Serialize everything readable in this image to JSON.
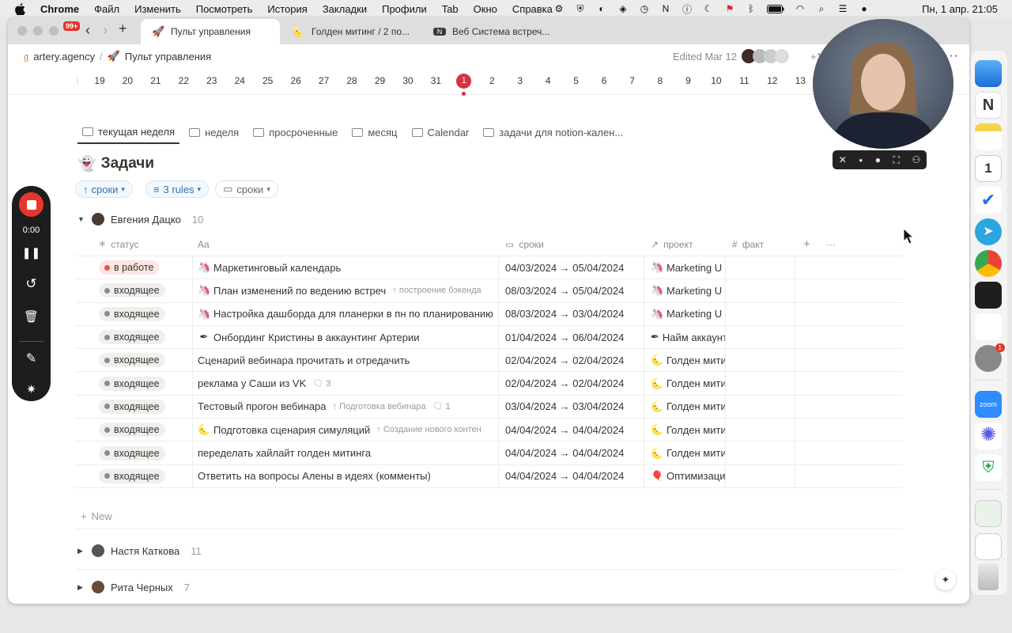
{
  "menubar": {
    "app": "Chrome",
    "items": [
      "Файл",
      "Изменить",
      "Посмотреть",
      "История",
      "Закладки",
      "Профили",
      "Tab",
      "Окно",
      "Справка"
    ],
    "clock": "Пн, 1 апр. 21:05"
  },
  "browser": {
    "tab_count_badge": "99+",
    "tabs": [
      {
        "label": "Пульт управления",
        "icon": "rocket-icon"
      },
      {
        "label": "Голден митинг / 2 по...",
        "icon": "moon-icon"
      },
      {
        "label": "Веб Система встреч...",
        "icon": "notion-icon"
      }
    ]
  },
  "breadcrumb": {
    "workspace": "artery.agency",
    "separator": "/",
    "page": "Пульт управления",
    "edited": "Edited Mar 12",
    "extra_avatars": "+1"
  },
  "datebar": {
    "dates": [
      "19",
      "20",
      "21",
      "22",
      "23",
      "24",
      "25",
      "26",
      "27",
      "28",
      "29",
      "30",
      "31",
      "1",
      "2",
      "3",
      "4",
      "5",
      "6",
      "7",
      "8",
      "9",
      "10",
      "11",
      "12",
      "13"
    ],
    "today_index": 13
  },
  "views": [
    "текущая неделя",
    "неделя",
    "просроченные",
    "месяц",
    "Calendar",
    "задачи для notion-кален..."
  ],
  "database": {
    "title": "Задачи",
    "sort_chip": "сроки",
    "rules_chip": "3 rules",
    "filter_chip": "сроки"
  },
  "groups": [
    {
      "name": "Евгения Дацко",
      "count": "10"
    },
    {
      "name": "Настя Каткова",
      "count": "11"
    },
    {
      "name": "Рита Черных",
      "count": "7"
    }
  ],
  "columns": {
    "status": "статус",
    "name": "Aa",
    "dates": "сроки",
    "project": "проект",
    "fact": "факт"
  },
  "rows": [
    {
      "status": "в работе",
      "status_color": "#e1584b",
      "icon": "unicorn",
      "title": "Маркетинговый календарь",
      "sub": "",
      "comments": "",
      "dates": "04/03/2024 → 05/04/2024",
      "project_icon": "unicorn",
      "project": "Marketing U"
    },
    {
      "status": "входящее",
      "status_color": "#8d8b86",
      "icon": "unicorn",
      "title": "План изменений по ведению встреч",
      "sub": "построение бэкенда",
      "comments": "",
      "dates": "08/03/2024 → 05/04/2024",
      "project_icon": "unicorn",
      "project": "Marketing U"
    },
    {
      "status": "входящее",
      "status_color": "#8d8b86",
      "icon": "unicorn",
      "title": "Настройка дашборда для планерки в пн по планированию",
      "sub": "",
      "comments": "",
      "dates": "08/03/2024 → 03/04/2024",
      "project_icon": "unicorn",
      "project": "Marketing U"
    },
    {
      "status": "входящее",
      "status_color": "#8d8b86",
      "icon": "pen",
      "title": "Онбординг Кристины в аккаунтинг Артерии",
      "sub": "",
      "comments": "",
      "dates": "01/04/2024 → 06/04/2024",
      "project_icon": "pen",
      "project": "Найм аккаунт"
    },
    {
      "status": "входящее",
      "status_color": "#8d8b86",
      "icon": "",
      "title": "Сценарий вебинара прочитать и отредачить",
      "sub": "",
      "comments": "",
      "dates": "02/04/2024 → 02/04/2024",
      "project_icon": "moon",
      "project": "Голден мити"
    },
    {
      "status": "входящее",
      "status_color": "#8d8b86",
      "icon": "",
      "title": "реклама у Саши из VK",
      "sub": "",
      "comments": "3",
      "dates": "02/04/2024 → 02/04/2024",
      "project_icon": "moon",
      "project": "Голден мити"
    },
    {
      "status": "входящее",
      "status_color": "#8d8b86",
      "icon": "",
      "title": "Тестовый прогон вебинара",
      "sub": "Подготовка вебинара",
      "comments": "1",
      "dates": "03/04/2024 → 03/04/2024",
      "project_icon": "moon",
      "project": "Голден мити"
    },
    {
      "status": "входящее",
      "status_color": "#8d8b86",
      "icon": "moon",
      "title": "Подготовка сценария симуляций",
      "sub": "Создание нового контен",
      "comments": "",
      "dates": "04/04/2024 → 04/04/2024",
      "project_icon": "moon",
      "project": "Голден мити"
    },
    {
      "status": "входящее",
      "status_color": "#8d8b86",
      "icon": "",
      "title": "переделать хайлайт голден митинга",
      "sub": "",
      "comments": "",
      "dates": "04/04/2024 → 04/04/2024",
      "project_icon": "moon",
      "project": "Голден мити"
    },
    {
      "status": "входящее",
      "status_color": "#8d8b86",
      "icon": "",
      "title": "Ответить на вопросы Алены в идеях (комменты)",
      "sub": "",
      "comments": "",
      "dates": "04/04/2024 → 04/04/2024",
      "project_icon": "balloon",
      "project": "Оптимизаци"
    }
  ],
  "new_label": "New",
  "recorder": {
    "timer": "0:00"
  },
  "dock_badges": {
    "settings": "1"
  }
}
